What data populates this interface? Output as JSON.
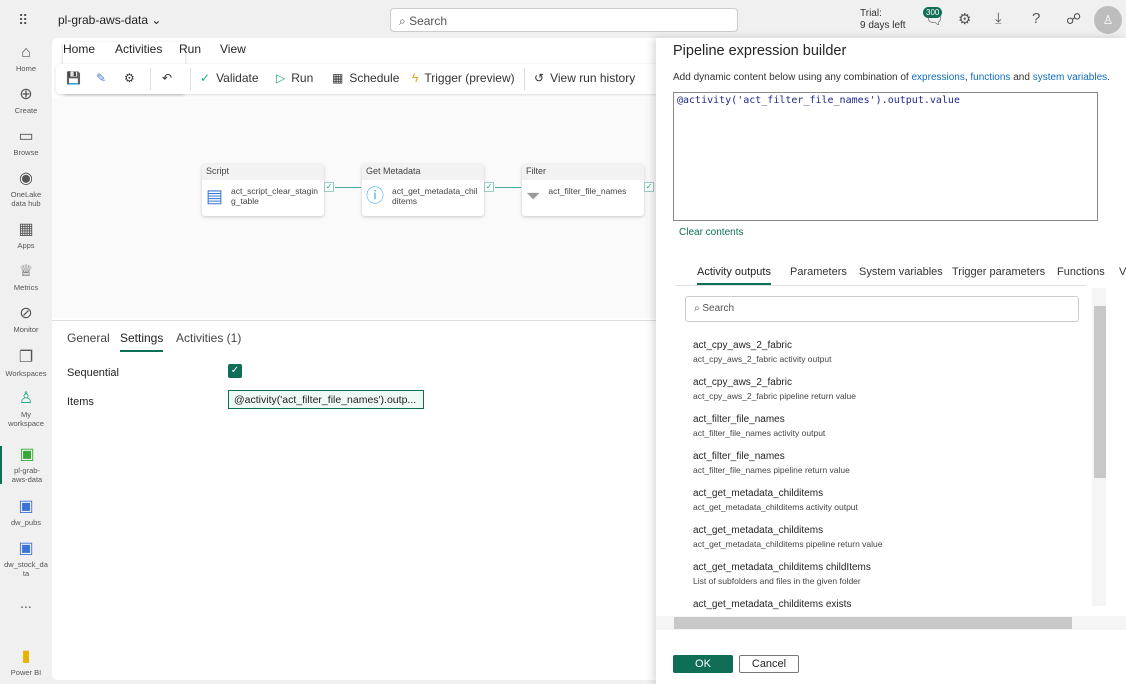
{
  "topbar": {
    "app_name": "pl-grab-aws-data",
    "search_placeholder": "Search",
    "trial_line1": "Trial:",
    "trial_line2": "9 days left",
    "notification_count": "300"
  },
  "nav": [
    {
      "label": "Home",
      "icon": "⌂"
    },
    {
      "label": "Create",
      "icon": "⊕"
    },
    {
      "label": "Browse",
      "icon": "▭"
    },
    {
      "label": "OneLake data hub",
      "icon": "◉"
    },
    {
      "label": "Apps",
      "icon": "▦"
    },
    {
      "label": "Metrics",
      "icon": "♕"
    },
    {
      "label": "Monitor",
      "icon": "⊘"
    },
    {
      "label": "Workspaces",
      "icon": "❐"
    },
    {
      "label": "My workspace",
      "icon": "♙"
    },
    {
      "label": "pl-grab-aws-data",
      "icon": "▣"
    },
    {
      "label": "dw_pubs",
      "icon": "▣"
    },
    {
      "label": "dw_stock_data",
      "icon": "▣"
    },
    {
      "label": "...",
      "icon": ""
    },
    {
      "label": "Power BI",
      "icon": "▮"
    }
  ],
  "ribbon": {
    "tabs": [
      "Home",
      "Activities",
      "Run",
      "View"
    ],
    "validate": "Validate",
    "run": "Run",
    "schedule": "Schedule",
    "trigger": "Trigger (preview)",
    "history": "View run history"
  },
  "activities": [
    {
      "type": "Script",
      "name": "act_script_clear_staging_table",
      "icon": "📜"
    },
    {
      "type": "Get Metadata",
      "name": "act_get_metadata_childitems",
      "icon": "ⓘ"
    },
    {
      "type": "Filter",
      "name": "act_filter_file_names",
      "icon": "⏷"
    }
  ],
  "bottom": {
    "tabs": [
      "General",
      "Settings",
      "Activities (1)"
    ],
    "sequential_label": "Sequential",
    "sequential_checked": true,
    "items_label": "Items",
    "items_value": "@activity('act_filter_file_names').outp..."
  },
  "panel": {
    "title": "Pipeline expression builder",
    "desc_prefix": "Add dynamic content below using any combination of ",
    "link1": "expressions",
    "sep1": ", ",
    "link2": "functions",
    "sep2": " and ",
    "link3": "system variables",
    "desc_suffix": ".",
    "expression": "@activity('act_filter_file_names').output.value",
    "clear": "Clear contents",
    "tabs": [
      "Activity outputs",
      "Parameters",
      "System variables",
      "Trigger parameters",
      "Functions",
      "V"
    ],
    "search_placeholder": "Search",
    "items": [
      {
        "name": "act_cpy_aws_2_fabric",
        "desc": "act_cpy_aws_2_fabric activity output"
      },
      {
        "name": "act_cpy_aws_2_fabric",
        "desc": "act_cpy_aws_2_fabric pipeline return value"
      },
      {
        "name": "act_filter_file_names",
        "desc": "act_filter_file_names activity output"
      },
      {
        "name": "act_filter_file_names",
        "desc": "act_filter_file_names pipeline return value"
      },
      {
        "name": "act_get_metadata_childitems",
        "desc": "act_get_metadata_childitems activity output"
      },
      {
        "name": "act_get_metadata_childitems",
        "desc": "act_get_metadata_childitems pipeline return value"
      },
      {
        "name": "act_get_metadata_childitems childItems",
        "desc": "List of subfolders and files in the given folder"
      },
      {
        "name": "act_get_metadata_childitems exists",
        "desc": ""
      }
    ],
    "ok": "OK",
    "cancel": "Cancel"
  }
}
